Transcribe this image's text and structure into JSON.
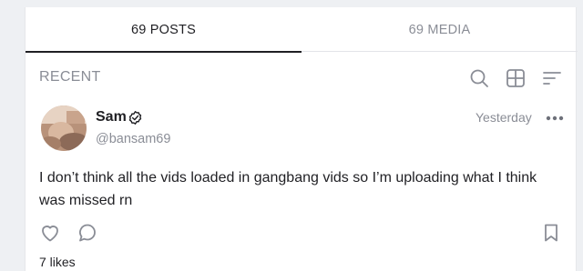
{
  "tabs": [
    {
      "label": "69 POSTS",
      "active": true
    },
    {
      "label": "69 MEDIA",
      "active": false
    }
  ],
  "feed": {
    "section_title": "RECENT",
    "tools": [
      "search-icon",
      "grid-icon",
      "sort-icon"
    ]
  },
  "post": {
    "author_name": "Sam",
    "author_handle": "@bansam69",
    "verified": true,
    "timestamp": "Yesterday",
    "text": "I don’t think all the vids loaded in gangbang vids so I’m uploading what I think was missed rn",
    "likes_text": "7 likes",
    "actions": [
      "heart-icon",
      "comment-icon",
      "bookmark-icon"
    ]
  },
  "colors": {
    "text_primary": "#1f1f23",
    "text_secondary": "#8a8d96",
    "icon": "#8a8d96",
    "background": "#eef0f3",
    "card": "#ffffff"
  }
}
